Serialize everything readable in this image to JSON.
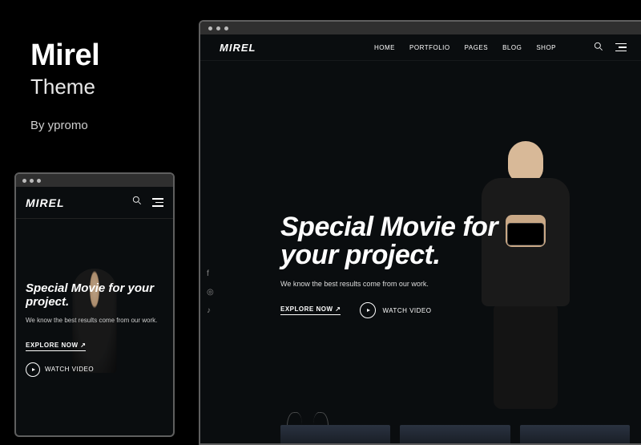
{
  "title": {
    "name": "Mirel",
    "subtitle": "Theme",
    "byline": "By ypromo"
  },
  "nav": {
    "logo": "MIREL",
    "items": [
      "HOME",
      "PORTFOLIO",
      "PAGES",
      "BLOG",
      "SHOP"
    ]
  },
  "hero": {
    "headline_desktop": "Special Movie for your project.",
    "headline_mobile": "Special Movie for your project.",
    "subline": "We know the best results come from our work.",
    "explore": "EXPLORE NOW ↗",
    "watch": "WATCH VIDEO"
  },
  "socials": {
    "facebook": "f",
    "instagram": "◎",
    "tiktok": "♪"
  }
}
